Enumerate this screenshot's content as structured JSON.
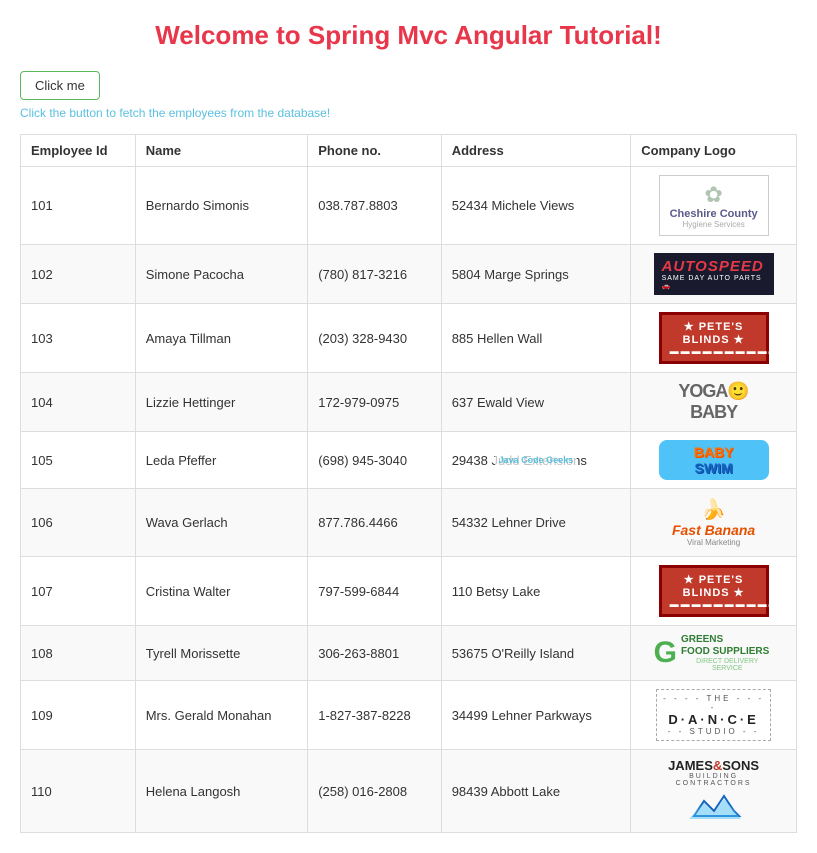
{
  "page": {
    "title": "Welcome to Spring Mvc Angular Tutorial!",
    "button_label": "Click me",
    "hint_text": "Click the button to fetch the employees from the database!"
  },
  "table": {
    "headers": [
      "Employee Id",
      "Name",
      "Phone no.",
      "Address",
      "Company Logo"
    ],
    "rows": [
      {
        "id": "101",
        "name": "Bernardo Simonis",
        "phone": "038.787.8803",
        "address": "52434 Michele Views",
        "logo": "cheshire"
      },
      {
        "id": "102",
        "name": "Simone Pacocha",
        "phone": "(780) 817-3216",
        "address": "5804 Marge Springs",
        "logo": "autospeed"
      },
      {
        "id": "103",
        "name": "Amaya Tillman",
        "phone": "(203) 328-9430",
        "address": "885 Hellen Wall",
        "logo": "petes1"
      },
      {
        "id": "104",
        "name": "Lizzie Hettinger",
        "phone": "172-979-0975",
        "address": "637 Ewald View",
        "logo": "yogababy"
      },
      {
        "id": "105",
        "name": "Leda Pfeffer",
        "phone": "(698) 945-3040",
        "address": "29438 Judd Extensions",
        "logo": "babyswim"
      },
      {
        "id": "106",
        "name": "Wava Gerlach",
        "phone": "877.786.4466",
        "address": "54332 Lehner Drive",
        "logo": "fastbanana"
      },
      {
        "id": "107",
        "name": "Cristina Walter",
        "phone": "797-599-6844",
        "address": "110 Betsy Lake",
        "logo": "petes2"
      },
      {
        "id": "108",
        "name": "Tyrell Morissette",
        "phone": "306-263-8801",
        "address": "53675 O'Reilly Island",
        "logo": "greens"
      },
      {
        "id": "109",
        "name": "Mrs. Gerald Monahan",
        "phone": "1-827-387-8228",
        "address": "34499 Lehner Parkways",
        "logo": "dance"
      },
      {
        "id": "110",
        "name": "Helena Langosh",
        "phone": "(258) 016-2808",
        "address": "98439 Abbott Lake",
        "logo": "james"
      }
    ]
  }
}
